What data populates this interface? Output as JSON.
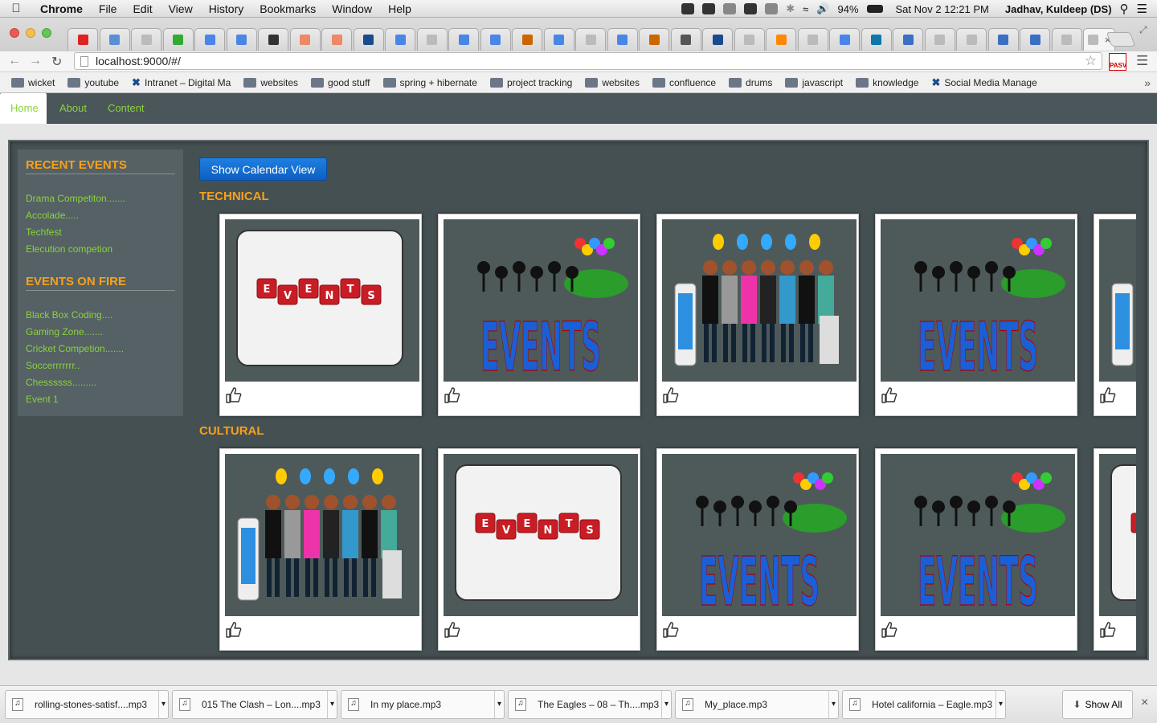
{
  "menubar": {
    "app": "Chrome",
    "items": [
      "File",
      "Edit",
      "View",
      "History",
      "Bookmarks",
      "Window",
      "Help"
    ],
    "battery": "94%",
    "datetime": "Sat Nov 2  12:21 PM",
    "user": "Jadhav, Kuldeep (DS)"
  },
  "address": {
    "url": "localhost:9000/#/"
  },
  "bookmarks": [
    {
      "label": "wicket",
      "icon": "folder-icon"
    },
    {
      "label": "youtube",
      "icon": "folder-icon"
    },
    {
      "label": "Intranet – Digital Ma",
      "icon": "x-icon"
    },
    {
      "label": "websites",
      "icon": "folder-icon"
    },
    {
      "label": "good stuff",
      "icon": "folder-icon"
    },
    {
      "label": "spring + hibernate",
      "icon": "folder-icon"
    },
    {
      "label": "project tracking",
      "icon": "folder-icon"
    },
    {
      "label": "websites",
      "icon": "folder-icon"
    },
    {
      "label": "confluence",
      "icon": "folder-icon"
    },
    {
      "label": "drums",
      "icon": "folder-icon"
    },
    {
      "label": "javascript",
      "icon": "folder-icon"
    },
    {
      "label": "knowledge",
      "icon": "folder-icon"
    },
    {
      "label": "Social Media Manage",
      "icon": "x-icon"
    }
  ],
  "nav": {
    "home": "Home",
    "about": "About",
    "content": "Content"
  },
  "sidebar": {
    "recent_title": "RECENT EVENTS",
    "recent": [
      "Drama Competiton.......",
      "Accolade.....",
      "Techfest",
      "Elecution competion"
    ],
    "fire_title": "EVENTS ON FIRE",
    "fire": [
      "Black Box Coding....",
      "Gaming Zone.......",
      "Cricket Competion.......",
      "Soccerrrrrrr..",
      "Chessssss.........",
      "Event 1"
    ]
  },
  "main": {
    "calendar_button": "Show Calendar View",
    "technical_title": "TECHNICAL",
    "cultural_title": "CULTURAL",
    "technical_cards": [
      "dice",
      "party",
      "crowd",
      "party",
      "crowd"
    ],
    "cultural_cards": [
      "crowd",
      "dice",
      "party",
      "party",
      "dice"
    ]
  },
  "downloads": {
    "files": [
      "rolling-stones-satisf....mp3",
      "015 The Clash – Lon....mp3",
      "In my place.mp3",
      "The Eagles – 08 – Th....mp3",
      "My_place.mp3",
      "Hotel california – Eagle.mp3"
    ],
    "show_all": "Show All"
  },
  "colors": {
    "accent_orange": "#f6a11b",
    "link_green": "#8bd23e",
    "nav_bg": "#4a5659",
    "panel_bg": "#455053",
    "button_blue": "#1a72d8"
  }
}
